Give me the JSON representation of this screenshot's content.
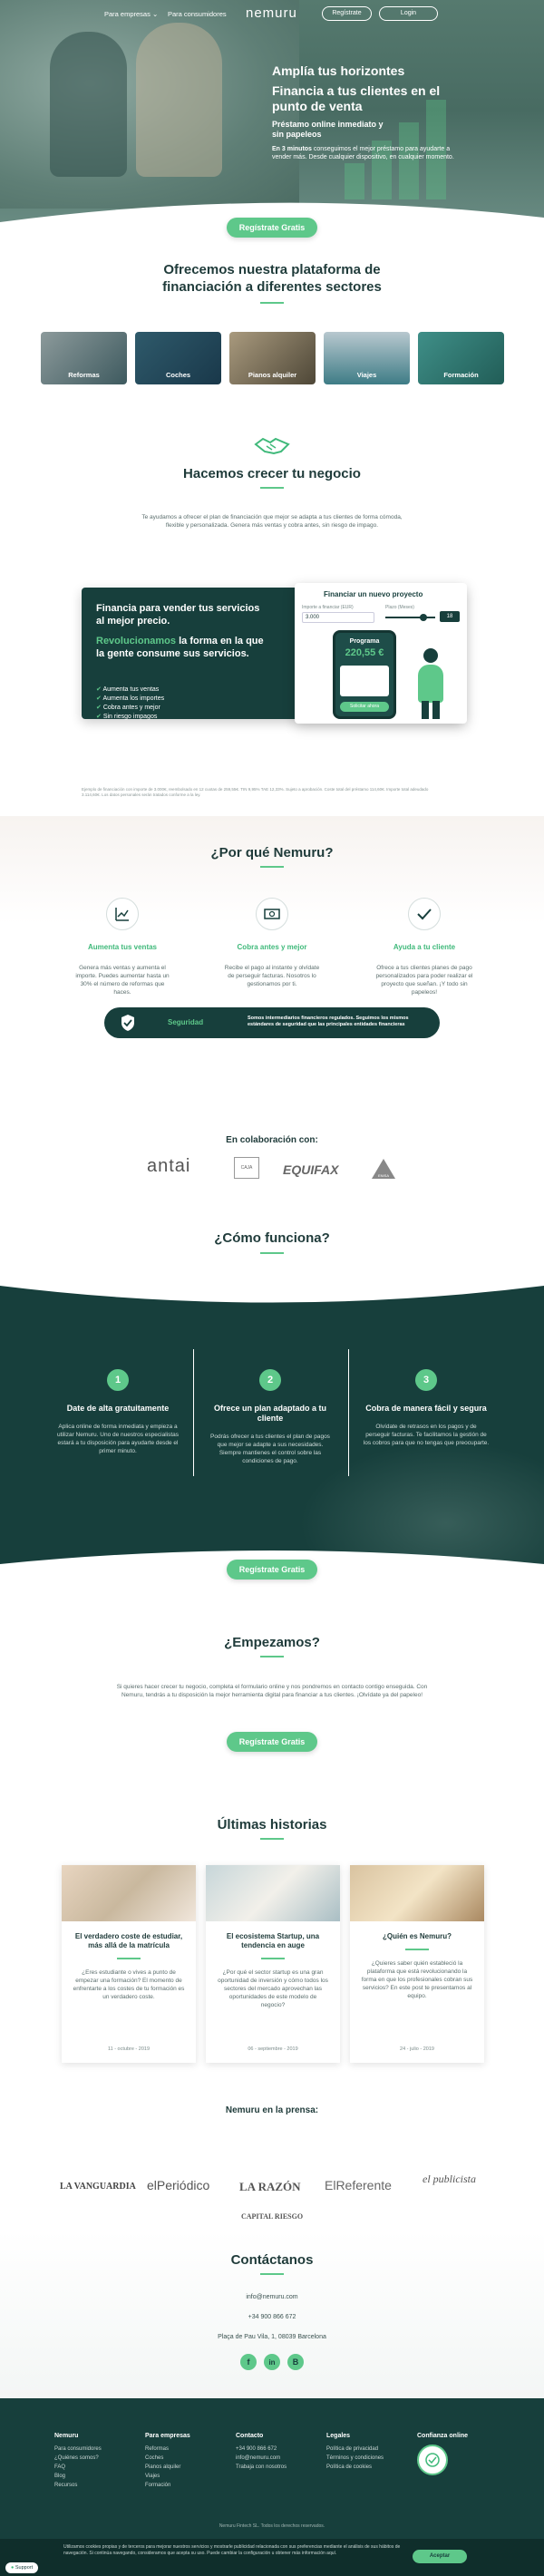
{
  "nav": {
    "link_empresas": "Para empresas",
    "link_consumidores": "Para consumidores",
    "logo": "nemuru",
    "registrate": "Regístrate",
    "login": "Login"
  },
  "hero": {
    "title1": "Amplía tus horizontes",
    "title2": "Financia a tus clientes en el punto de venta",
    "subtitle": "Préstamo online inmediato y sin papeleos",
    "text_bold": "En 3 minutos",
    "text": "conseguimos el mejor préstamo para ayudarte a vender más. Desde cualquier dispositivo, en cualquier momento.",
    "button": "Regístrate Gratis"
  },
  "sectors": {
    "title": "Ofrecemos nuestra plataforma de financiación a diferentes sectores",
    "items": [
      "Reformas",
      "Coches",
      "Pianos alquiler",
      "Viajes",
      "Formación"
    ]
  },
  "grow": {
    "title": "Hacemos crecer tu negocio",
    "text": "Te ayudamos a ofrecer el plan de financiación que mejor se adapta a tus clientes de forma cómoda, flexible y personalizada. Genera más ventas y cobra antes, sin riesgo de impago."
  },
  "promo": {
    "title": "Financia para vender tus servicios al mejor precio.",
    "highlight": "Revolucionamos",
    "title2": "la forma en la que la gente consume sus servicios.",
    "checks": [
      "Aumenta tus ventas",
      "Aumenta los importes",
      "Cobra antes y mejor",
      "Sin riesgo impagos"
    ],
    "card_title": "Financiar un nuevo proyecto",
    "card_label1": "Importe a financiar (EUR)",
    "card_value1": "3.000",
    "card_label2": "Plazo (Meses)",
    "card_value2": "18",
    "phone_title": "Programa",
    "phone_amount": "220,55 €",
    "phone_btn": "Solicitar ahora",
    "disclaimer": "Ejemplo de financiación con importe de 3.000€, reembolsado en 12 cuotas de 259,55€. TIN 9,95% TAE 12,33%. Sujeto a aprobación. Coste total del préstamo 114,60€. Importe total adeudado 3.114,60€. Los datos personales serán tratados conforme a la ley."
  },
  "why": {
    "title": "¿Por qué Nemuru?",
    "cols": [
      {
        "title": "Aumenta tus ventas",
        "text": "Genera más ventas y aumenta el importe. Puedes aumentar hasta un 30% el número de reformas que haces."
      },
      {
        "title": "Cobra antes y mejor",
        "text": "Recibe el pago al instante y olvídate de perseguir facturas. Nosotros lo gestionamos por ti."
      },
      {
        "title": "Ayuda a tu cliente",
        "text": "Ofrece a tus clientes planes de pago personalizados para poder realizar el proyecto que sueñan. ¡Y todo sin papeleos!"
      }
    ],
    "security_label": "Seguridad",
    "security_text": "Somos intermediarios financieros regulados. Seguimos los mismos estándares de seguridad que las principales entidades financieras"
  },
  "partners": {
    "title": "En colaboración con:",
    "logos": [
      "antai",
      "CAJA",
      "EQUIFAX",
      "ENISA"
    ]
  },
  "how": {
    "title": "¿Cómo funciona?",
    "steps": [
      {
        "num": "1",
        "title": "Date de alta gratuitamente",
        "text": "Aplica online de forma inmediata y empieza a utilizar Nemuru. Uno de nuestros especialistas estará a tu disposición para ayudarte desde el primer minuto."
      },
      {
        "num": "2",
        "title": "Ofrece un plan adaptado a tu cliente",
        "text": "Podrás ofrecer a tus clientes el plan de pagos que mejor se adapte a sus necesidades. Siempre mantienes el control sobre las condiciones de pago."
      },
      {
        "num": "3",
        "title": "Cobra de manera fácil y segura",
        "text": "Olvídate de retrasos en los pagos y de perseguir facturas. Te facilitamos la gestión de los cobros para que no tengas que preocuparte."
      }
    ],
    "button": "Regístrate Gratis"
  },
  "start": {
    "title": "¿Empezamos?",
    "text": "Si quieres hacer crecer tu negocio, completa el formulario online y nos pondremos en contacto contigo enseguida. Con Nemuru, tendrás a tu disposición la mejor herramienta digital para financiar a tus clientes. ¡Olvídate ya del papeleo!",
    "button": "Regístrate Gratis"
  },
  "stories": {
    "title": "Últimas historias",
    "items": [
      {
        "title": "El verdadero coste de estudiar, más allá de la matrícula",
        "text": "¿Eres estudiante o vives a punto de empezar una formación? El momento de enfrentarte a los costes de tu formación es un verdadero coste.",
        "date": "11 - octubre - 2019"
      },
      {
        "title": "El ecosistema Startup, una tendencia en auge",
        "text": "¿Por qué el sector startup es una gran oportunidad de inversión y cómo todos los sectores del mercado aprovechan las oportunidades de este modelo de negocio?",
        "date": "06 - septiembre - 2019"
      },
      {
        "title": "¿Quién es Nemuru?",
        "text": "¿Quieres saber quién estableció la plataforma que está revolucionando la forma en que los profesionales cobran sus servicios? En este post te presentamos al equipo.",
        "date": "24 - julio - 2019"
      }
    ]
  },
  "press": {
    "title": "Nemuru en la prensa:",
    "logos": [
      "LA VANGUARDIA",
      "elPeriódico",
      "LA RAZÓN",
      "ElReferente",
      "el publicista",
      "CAPITAL RIESGO"
    ]
  },
  "contact": {
    "title": "Contáctanos",
    "email": "info@nemuru.com",
    "phone": "+34 900 866 672",
    "address": "Plaça de Pau Vila, 1, 08039 Barcelona"
  },
  "footer": {
    "cols": [
      {
        "title": "Nemuru",
        "items": [
          "Para consumidores",
          "¿Quiénes somos?",
          "FAQ",
          "Blog",
          "Recursos"
        ]
      },
      {
        "title": "Para empresas",
        "items": [
          "Reformas",
          "Coches",
          "Pianos alquiler",
          "Viajes",
          "Formación"
        ]
      },
      {
        "title": "Contacto",
        "items": [
          "+34 900 866 672",
          "info@nemuru.com",
          "Trabaja con nosotros"
        ]
      },
      {
        "title": "Legales",
        "items": [
          "Política de privacidad",
          "Términos y condiciones",
          "Política de cookies"
        ]
      },
      {
        "title": "Confianza online",
        "items": []
      }
    ],
    "copyright": "Nemuru Fintech SL. Todos los derechos reservados.",
    "cookie_text": "Utilizamos cookies propias y de terceros para mejorar nuestros servicios y mostrarle publicidad relacionada con sus preferencias mediante el análisis de sus hábitos de navegación. Si continúa navegando, consideramos que acepta su uso. Puede cambiar la configuración u obtener más información aquí.",
    "cookie_btn": "Aceptar",
    "support": "Support"
  },
  "colors": {
    "accent": "#5ec88a",
    "dark": "#173f3c"
  }
}
